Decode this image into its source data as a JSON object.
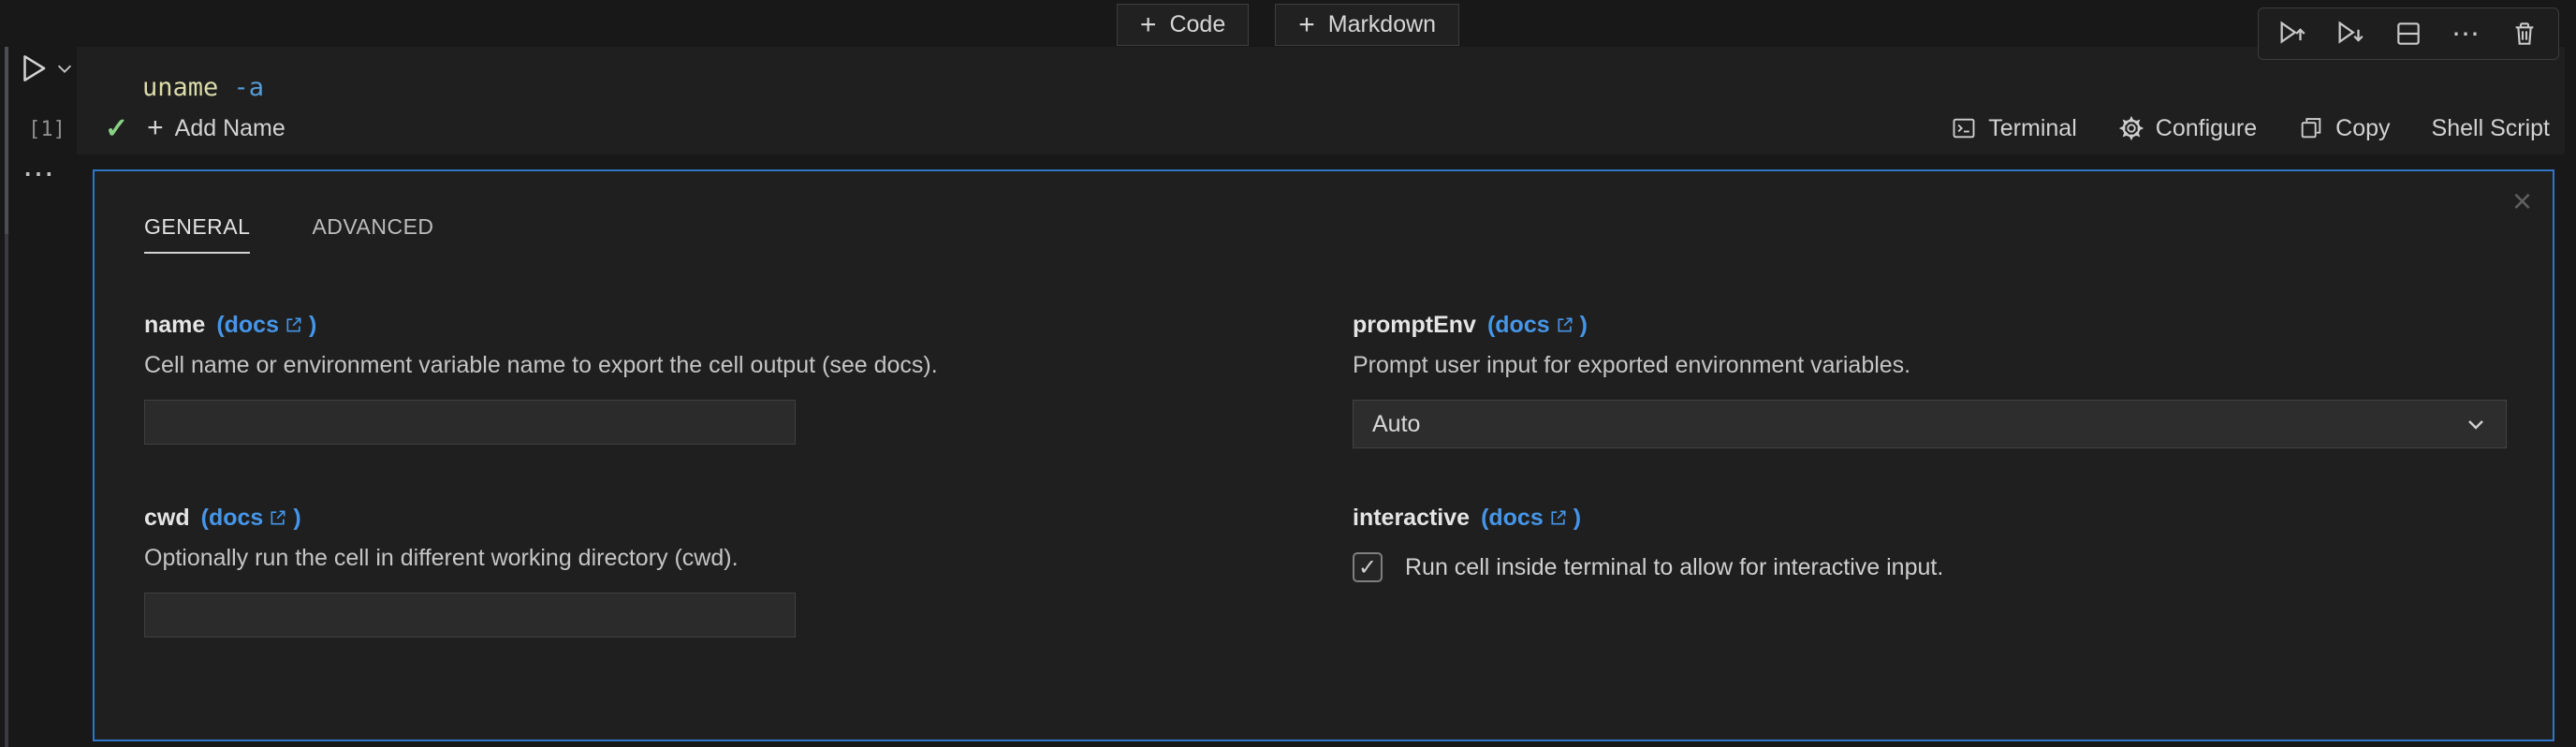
{
  "colors": {
    "focus_border": "#3274c6",
    "link_blue": "#4596e8",
    "code_command": "#dcdcaa",
    "code_flag": "#569cd6",
    "success_green": "#89d185",
    "background": "#1f1f1f"
  },
  "top_bar": {
    "plus_glyph": "+",
    "code_button": "Code",
    "markdown_button": "Markdown"
  },
  "cell_toolbar": {
    "icons": [
      "execute-above",
      "execute-below",
      "split-cell",
      "more-actions",
      "delete-cell"
    ],
    "more_glyph": "⋯"
  },
  "cell": {
    "execution_count": "[1]",
    "code": {
      "command": "uname",
      "argument": "-a"
    },
    "success_glyph": "✓",
    "add_name_plus": "+",
    "add_name_label": "Add Name",
    "more_glyph": "⋯",
    "status_bar": {
      "terminal": "Terminal",
      "configure": "Configure",
      "copy": "Copy",
      "language": "Shell Script"
    }
  },
  "panel": {
    "close_glyph": "×",
    "tabs": [
      {
        "label": "GENERAL",
        "active": true
      },
      {
        "label": "ADVANCED",
        "active": false
      }
    ],
    "fields": {
      "name": {
        "label": "name",
        "docs_label": "(docs",
        "docs_close": ")",
        "description": "Cell name or environment variable name to export the cell output (see docs).",
        "value": "",
        "placeholder": ""
      },
      "cwd": {
        "label": "cwd",
        "docs_label": "(docs",
        "docs_close": ")",
        "description": "Optionally run the cell in different working directory (cwd).",
        "value": "",
        "placeholder": ""
      },
      "promptEnv": {
        "label": "promptEnv",
        "docs_label": "(docs",
        "docs_close": ")",
        "description": "Prompt user input for exported environment variables.",
        "value": "Auto"
      },
      "interactive": {
        "label": "interactive",
        "docs_label": "(docs",
        "docs_close": ")",
        "checked": true,
        "check_glyph": "✓",
        "checkbox_label": "Run cell inside terminal to allow for interactive input."
      }
    }
  }
}
